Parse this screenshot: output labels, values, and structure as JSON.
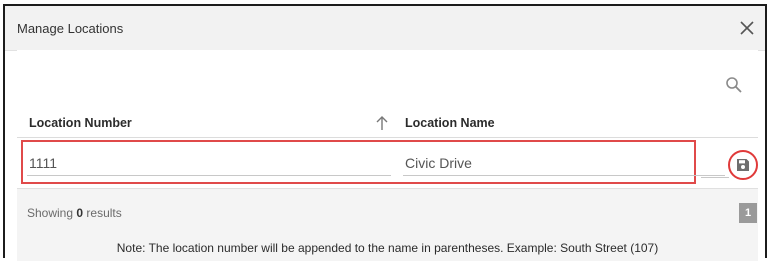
{
  "dialog": {
    "title": "Manage Locations",
    "close_icon": "close-icon"
  },
  "table": {
    "search_icon": "search-icon",
    "columns": [
      {
        "label": "Location Number",
        "sort_icon": "arrow-up-icon"
      },
      {
        "label": "Location Name"
      }
    ],
    "edit_row": {
      "location_number": "1111",
      "location_name": "Civic Drive"
    },
    "save_icon": "save-floppy-icon"
  },
  "footer": {
    "showing_prefix": "Showing",
    "result_count": "0",
    "showing_suffix": "results",
    "page_number": "1",
    "note": "Note: The location number will be appended to the name in parentheses. Example: South Street (107)"
  },
  "colors": {
    "highlight": "#e04a4a",
    "page_button": "#9a9a9a"
  }
}
